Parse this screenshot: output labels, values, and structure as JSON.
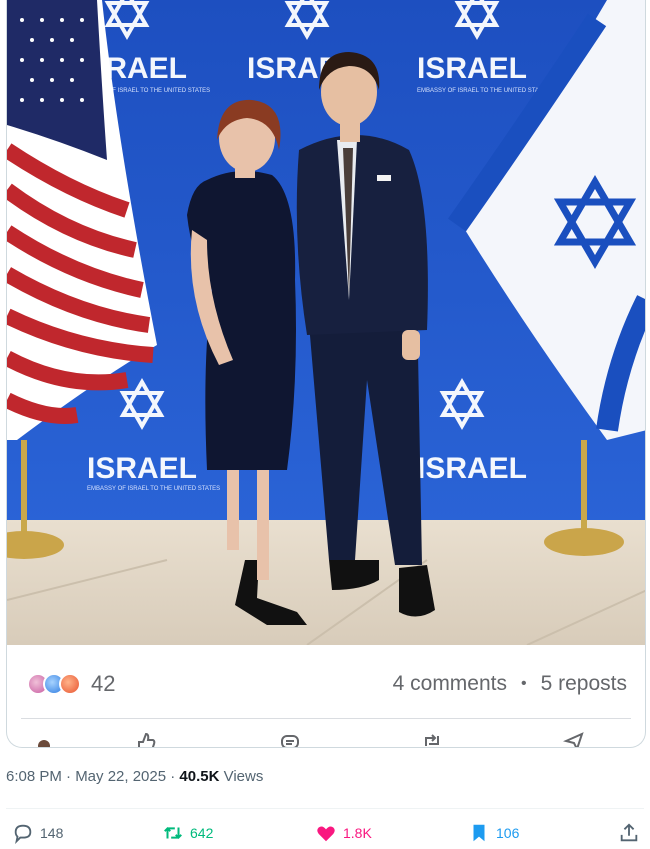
{
  "post": {
    "reaction_count": "42",
    "comments": "4 comments",
    "separator": "•",
    "reposts": "5 reposts",
    "banner_text": "ISRAEL",
    "banner_subtext": "EMBASSY OF ISRAEL TO THE UNITED STATES"
  },
  "meta": {
    "time": "6:08 PM · May 22, 2025 · ",
    "views_count": "40.5K",
    "views_label": " Views"
  },
  "actions": {
    "replies": "148",
    "reposts": "642",
    "likes": "1.8K",
    "bookmarks": "106"
  },
  "colors": {
    "backdrop_blue": "#1f56c9",
    "reply_gray": "#536471",
    "retweet_green": "#00ba7c",
    "like_pink": "#f91880",
    "bookmark_blue": "#1d9bf0"
  }
}
